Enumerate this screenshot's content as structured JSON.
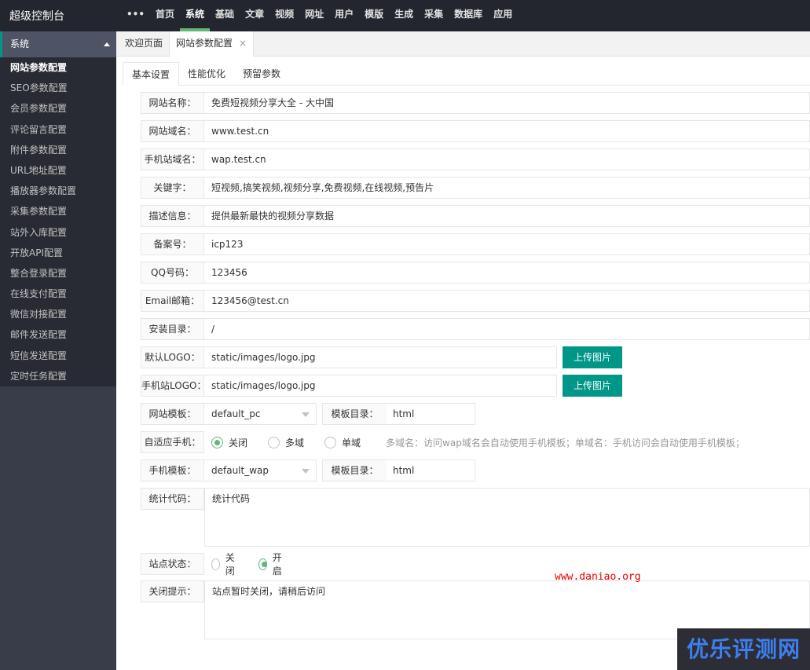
{
  "app": {
    "title": "超级控制台"
  },
  "topnav": [
    "•••",
    "首页",
    "系统",
    "基础",
    "文章",
    "视频",
    "网址",
    "用户",
    "模版",
    "生成",
    "采集",
    "数据库",
    "应用"
  ],
  "sidebar": {
    "section": "系统",
    "items": [
      "网站参数配置",
      "SEO参数配置",
      "会员参数配置",
      "评论留言配置",
      "附件参数配置",
      "URL地址配置",
      "播放器参数配置",
      "采集参数配置",
      "站外入库配置",
      "开放API配置",
      "整合登录配置",
      "在线支付配置",
      "微信对接配置",
      "邮件发送配置",
      "短信发送配置",
      "定时任务配置"
    ]
  },
  "pagetabs": {
    "welcome": "欢迎页面",
    "current": "网站参数配置",
    "close": "×"
  },
  "subtabs": [
    "基本设置",
    "性能优化",
    "预留参数"
  ],
  "form": {
    "site_name": {
      "label": "网站名称：",
      "value": "免费短视频分享大全 - 大中国"
    },
    "site_domain": {
      "label": "网站域名：",
      "value": "www.test.cn"
    },
    "wap_domain": {
      "label": "手机站域名：",
      "value": "wap.test.cn"
    },
    "keywords": {
      "label": "关键字：",
      "value": "短视频,搞笑视频,视频分享,免费视频,在线视频,预告片"
    },
    "description": {
      "label": "描述信息：",
      "value": "提供最新最快的视频分享数据"
    },
    "icp": {
      "label": "备案号：",
      "value": "icp123"
    },
    "qq": {
      "label": "QQ号码：",
      "value": "123456"
    },
    "email": {
      "label": "Email邮箱：",
      "value": "123456@test.cn"
    },
    "install_dir": {
      "label": "安装目录：",
      "value": "/"
    },
    "logo": {
      "label": "默认LOGO：",
      "value": "static/images/logo.jpg",
      "button": "上传图片"
    },
    "wap_logo": {
      "label": "手机站LOGO：",
      "value": "static/images/logo.jpg",
      "button": "上传图片"
    },
    "template": {
      "label": "网站模板：",
      "value": "default_pc",
      "dir_label": "模板目录：",
      "dir_value": "html"
    },
    "adaptive": {
      "label": "自适应手机：",
      "options": [
        "关闭",
        "多域",
        "单域"
      ],
      "hint": "多域名：访问wap域名会自动使用手机模板；单域名：手机访问会自动使用手机模板；"
    },
    "wap_template": {
      "label": "手机模板：",
      "value": "default_wap",
      "dir_label": "模板目录：",
      "dir_value": "html"
    },
    "stats": {
      "label": "统计代码：",
      "value": "统计代码"
    },
    "status": {
      "label": "站点状态：",
      "options": [
        "关闭",
        "开启"
      ]
    },
    "close_tip": {
      "label": "关闭提示：",
      "value": "站点暂时关闭，请稍后访问"
    }
  },
  "watermarks": {
    "site": "www.daniao.org",
    "badge": "优乐评测网"
  },
  "colors": {
    "accent": "#009688",
    "active_green": "#5fb878",
    "header": "#23262e",
    "sidebar": "#393d49",
    "watermark_red": "#e60000"
  }
}
